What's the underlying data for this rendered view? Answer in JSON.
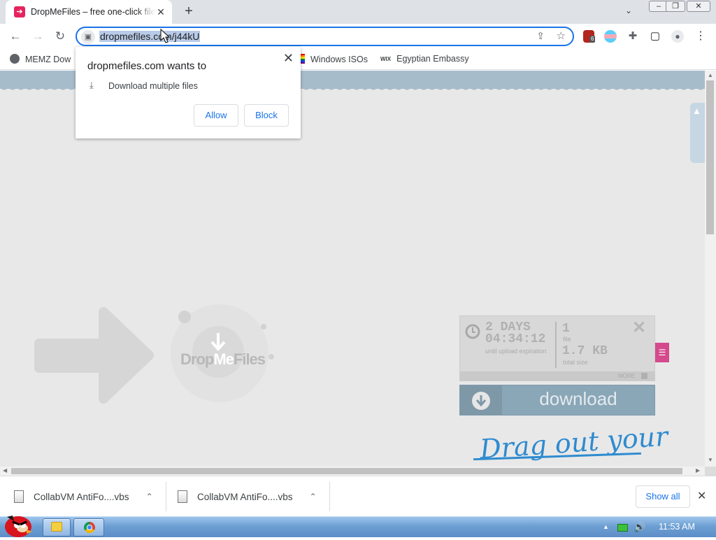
{
  "browser": {
    "tab": {
      "title": "DropMeFiles – free one-click file sharing",
      "close": "✕"
    },
    "new_tab": "+",
    "tab_list": "⌄",
    "window_controls": {
      "minimize": "–",
      "restore": "❐",
      "close": "✕"
    },
    "nav": {
      "back": "←",
      "forward": "→",
      "reload": "↻"
    },
    "omnibox": {
      "url": "dropmefiles.com/j44kU",
      "lock": "🔒",
      "share": "⇪",
      "star": "☆"
    },
    "extensions": [
      {
        "name": "ublock-origin-icon",
        "badge": "6"
      },
      {
        "name": "profile-ext-icon"
      },
      {
        "name": "extensions-puzzle-icon",
        "glyph": "✚"
      },
      {
        "name": "side-panel-icon",
        "glyph": "▢"
      },
      {
        "name": "account-avatar-icon",
        "glyph": "●"
      },
      {
        "name": "menu-kebab-icon",
        "glyph": "⋮"
      }
    ],
    "bookmarks": [
      {
        "label": "MEMZ Dow"
      },
      {
        "label": "Windows ISOs"
      },
      {
        "label": "Egyptian Embassy",
        "icon_text": "WIX"
      }
    ]
  },
  "permission_popup": {
    "heading": "dropmefiles.com wants to",
    "item": "Download multiple files",
    "allow": "Allow",
    "block": "Block",
    "close": "✕"
  },
  "page": {
    "logo_text_drop": "Drop",
    "logo_text_me": "Me",
    "logo_text_files": "Files",
    "info": {
      "days": "2 DAYS",
      "time": "04:34:12",
      "expiration_caption": "until upload expiration",
      "files_count": "1",
      "files_caption": "file",
      "size": "1.7 KB",
      "size_caption": "total size",
      "more": "MORE",
      "close": "✕"
    },
    "download_button": "download",
    "drag_text": "Drag out your"
  },
  "downloads": [
    {
      "name": "CollabVM AntiFo....vbs"
    },
    {
      "name": "CollabVM AntiFo....vbs"
    }
  ],
  "show_all": "Show all",
  "shelf_close": "✕",
  "taskbar": {
    "clock": "11:53 AM"
  },
  "colors": {
    "accent": "#1a73e8",
    "dropme_pink": "#e5245e",
    "download_blue": "#8aa7b8"
  }
}
